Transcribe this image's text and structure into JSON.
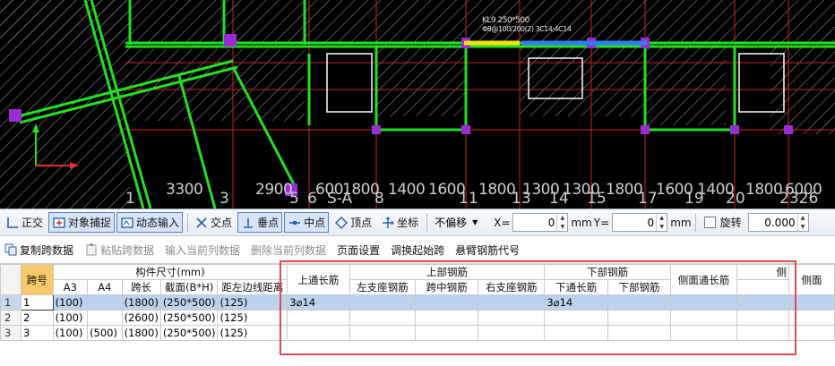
{
  "axis_labels": [
    "1",
    "3",
    "5",
    "6",
    "S-A",
    "8",
    "11",
    "13",
    "14",
    "15",
    "17",
    "19",
    "20",
    "2326"
  ],
  "dim_labels": [
    "3300",
    "2900",
    "600",
    "1800",
    "1400",
    "1600",
    "1800",
    "1300",
    "1300",
    "1800",
    "1600",
    "1400",
    "1800",
    "6000"
  ],
  "beam_annotation": "KL9 250*500",
  "beam_annotation_2": "Φ8@100/200(2) 3C14;4C14",
  "toolbar": {
    "ortho": "正交",
    "snap": "对象捕捉",
    "dynamic_input": "动态输入",
    "intersection": "交点",
    "perpendicular": "垂点",
    "midpoint": "中点",
    "vertex": "顶点",
    "coordinate": "坐标",
    "offset_mode": "不偏移",
    "x_label": "X=",
    "x_value": "0",
    "x_unit": "mm",
    "y_label": "Y=",
    "y_value": "0",
    "y_unit": "mm",
    "rotate_label": "旋转",
    "rotate_value": "0.000"
  },
  "toolbar2": {
    "copy_span": "复制跨数据",
    "paste_span": "粘贴跨数据",
    "input_column": "输入当前列数据",
    "delete_column": "删除当前列数据",
    "page_setup": "页面设置",
    "swap_start": "调换起始跨",
    "cantilever_code": "悬臂钢筋代号"
  },
  "grid": {
    "span_no": "跨号",
    "member_size": "构件尺寸(mm)",
    "cols_size": [
      "A3",
      "A4",
      "跨长",
      "截面(B*H)",
      "距左边线距离"
    ],
    "top_through": "上通长筋",
    "top_rebar": "上部钢筋",
    "top_sub": [
      "左支座钢筋",
      "跨中钢筋",
      "右支座钢筋"
    ],
    "bottom_rebar": "下部钢筋",
    "bottom_sub": [
      "下通长筋",
      "下部钢筋"
    ],
    "side_through": "侧面通长筋",
    "side_group": "侧",
    "side_sub": "侧面",
    "rows": [
      {
        "no": "1",
        "span": "1",
        "a3": "(100)",
        "a4": "",
        "len": "(1800)",
        "sec": "(250*500)",
        "dist": "(125)",
        "top_through": "3⌀14",
        "bottom_through": "3⌀14"
      },
      {
        "no": "2",
        "span": "2",
        "a3": "(100)",
        "a4": "",
        "len": "(2600)",
        "sec": "(250*500)",
        "dist": "(125)",
        "top_through": "",
        "bottom_through": ""
      },
      {
        "no": "3",
        "span": "3",
        "a3": "(100)",
        "a4": "(500)",
        "len": "(1800)",
        "sec": "(250*500)",
        "dist": "(125)",
        "top_through": "",
        "bottom_through": ""
      }
    ]
  }
}
